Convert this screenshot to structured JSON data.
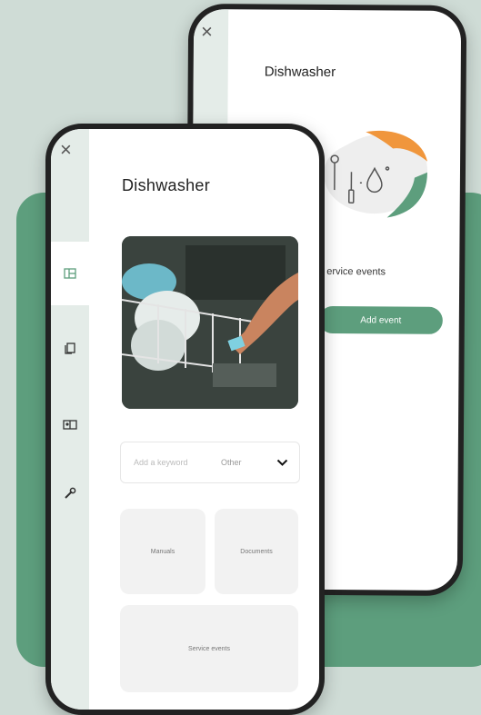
{
  "back_screen": {
    "close_glyph": "×",
    "title": "Dishwasher",
    "service_events_label": "ervice events",
    "add_event_label": "Add event",
    "illustration_icons": [
      "screwdriver-icon",
      "water-drop-icon",
      "tools-icon"
    ]
  },
  "front_screen": {
    "close_glyph": "×",
    "title": "Dishwasher",
    "nav_icons": [
      "overview-icon",
      "documents-icon",
      "gallery-icon",
      "wrench-icon"
    ],
    "search": {
      "placeholder": "Add a keyword",
      "filter": "Other"
    },
    "tiles": {
      "manuals": "Manuals",
      "documents": "Documents",
      "service_events": "Service events"
    }
  },
  "colors": {
    "accent": "#5d9e7d",
    "background": "#cfdcd6",
    "orange": "#f0963c"
  }
}
